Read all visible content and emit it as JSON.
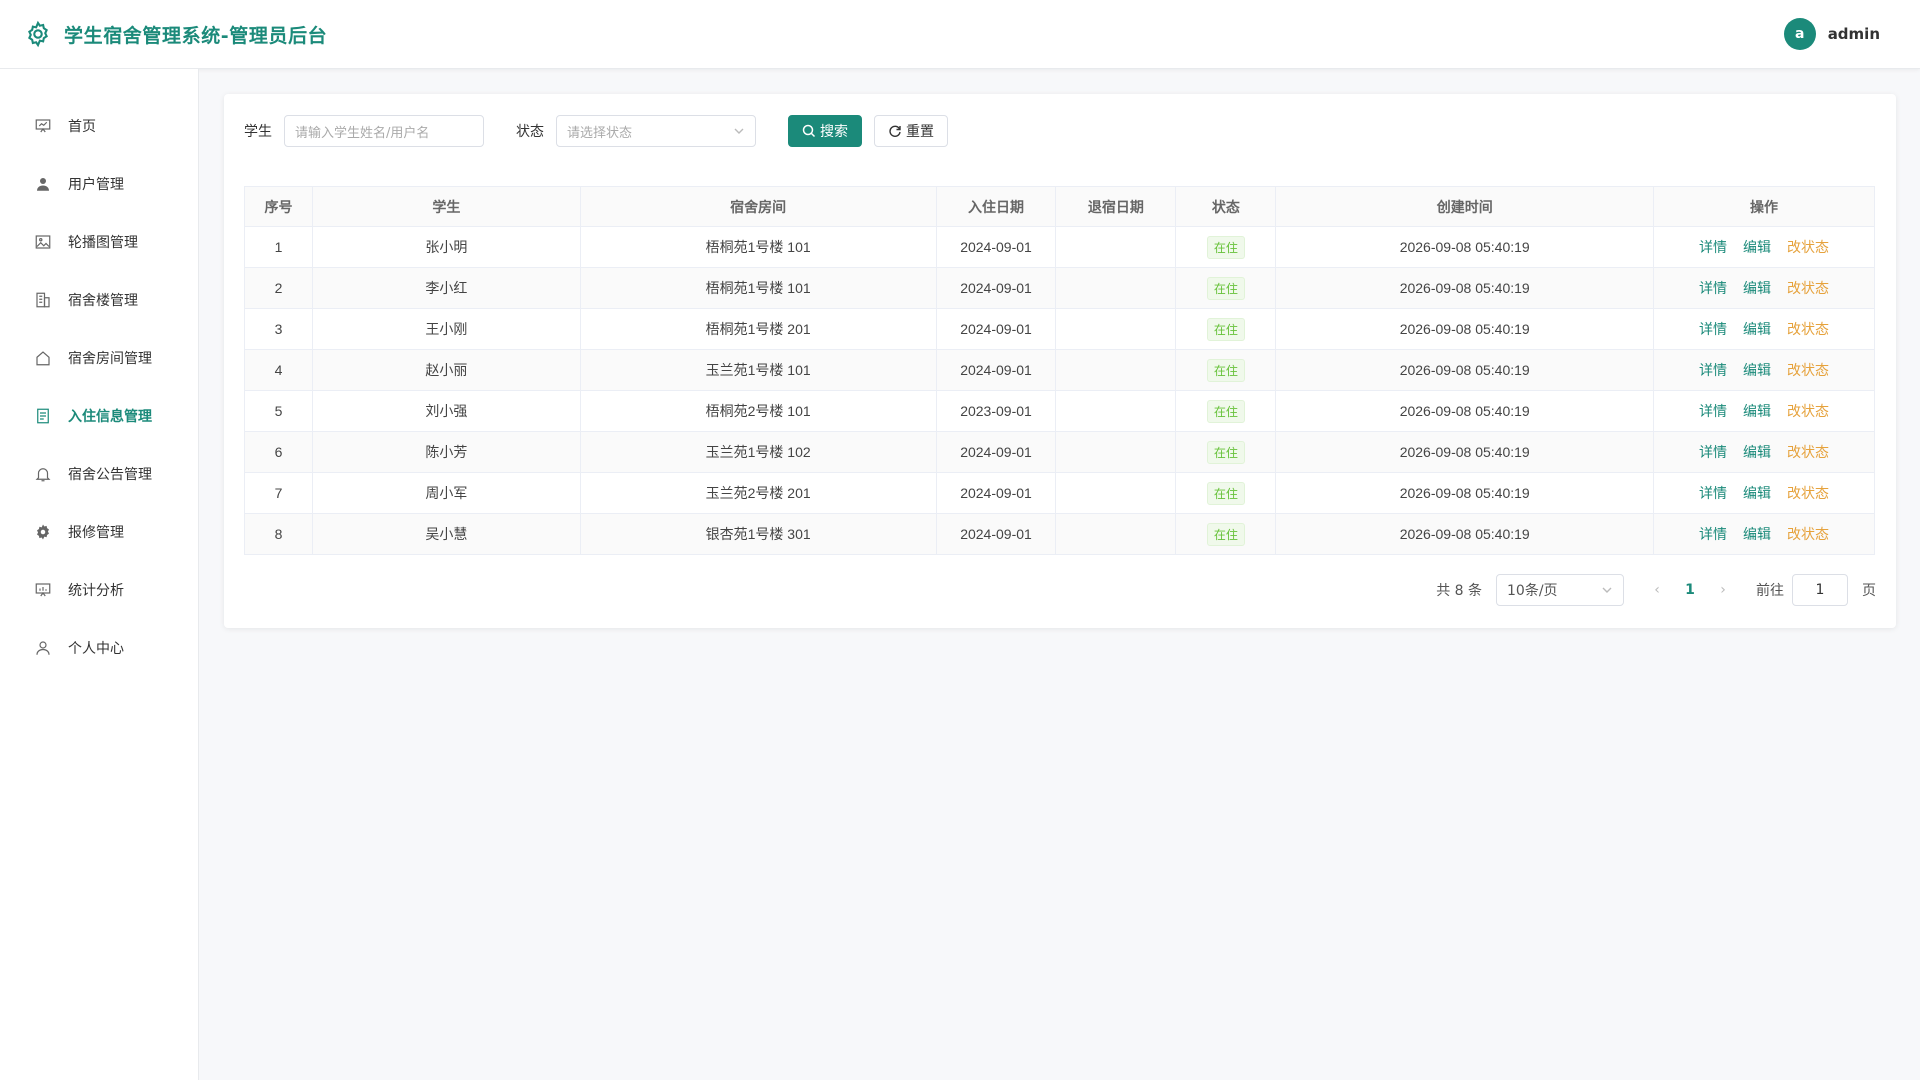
{
  "header": {
    "title": "学生宿舍管理系统-管理员后台",
    "avatar_letter": "a",
    "username": "admin"
  },
  "sidebar": {
    "items": [
      {
        "label": "首页",
        "icon": "home-chart-icon",
        "active": false
      },
      {
        "label": "用户管理",
        "icon": "user-icon",
        "active": false
      },
      {
        "label": "轮播图管理",
        "icon": "picture-icon",
        "active": false
      },
      {
        "label": "宿舍楼管理",
        "icon": "building-icon",
        "active": false
      },
      {
        "label": "宿舍房间管理",
        "icon": "house-icon",
        "active": false
      },
      {
        "label": "入住信息管理",
        "icon": "document-icon",
        "active": true
      },
      {
        "label": "宿舍公告管理",
        "icon": "bell-icon",
        "active": false
      },
      {
        "label": "报修管理",
        "icon": "gear-icon",
        "active": false
      },
      {
        "label": "统计分析",
        "icon": "chart-board-icon",
        "active": false
      },
      {
        "label": "个人中心",
        "icon": "person-outline-icon",
        "active": false
      }
    ]
  },
  "filters": {
    "student_label": "学生",
    "student_placeholder": "请输入学生姓名/用户名",
    "status_label": "状态",
    "status_placeholder": "请选择状态",
    "search_label": "搜索",
    "reset_label": "重置"
  },
  "table": {
    "columns": [
      "序号",
      "学生",
      "宿舍房间",
      "入住日期",
      "退宿日期",
      "状态",
      "创建时间",
      "操作"
    ],
    "rows": [
      {
        "index": "1",
        "student": "张小明",
        "room": "梧桐苑1号楼 101",
        "checkin": "2024-09-01",
        "checkout": "",
        "status": "在住",
        "created": "2026-09-08 05:40:19"
      },
      {
        "index": "2",
        "student": "李小红",
        "room": "梧桐苑1号楼 101",
        "checkin": "2024-09-01",
        "checkout": "",
        "status": "在住",
        "created": "2026-09-08 05:40:19"
      },
      {
        "index": "3",
        "student": "王小刚",
        "room": "梧桐苑1号楼 201",
        "checkin": "2024-09-01",
        "checkout": "",
        "status": "在住",
        "created": "2026-09-08 05:40:19"
      },
      {
        "index": "4",
        "student": "赵小丽",
        "room": "玉兰苑1号楼 101",
        "checkin": "2024-09-01",
        "checkout": "",
        "status": "在住",
        "created": "2026-09-08 05:40:19"
      },
      {
        "index": "5",
        "student": "刘小强",
        "room": "梧桐苑2号楼 101",
        "checkin": "2023-09-01",
        "checkout": "",
        "status": "在住",
        "created": "2026-09-08 05:40:19"
      },
      {
        "index": "6",
        "student": "陈小芳",
        "room": "玉兰苑1号楼 102",
        "checkin": "2024-09-01",
        "checkout": "",
        "status": "在住",
        "created": "2026-09-08 05:40:19"
      },
      {
        "index": "7",
        "student": "周小军",
        "room": "玉兰苑2号楼 201",
        "checkin": "2024-09-01",
        "checkout": "",
        "status": "在住",
        "created": "2026-09-08 05:40:19"
      },
      {
        "index": "8",
        "student": "吴小慧",
        "room": "银杏苑1号楼 301",
        "checkin": "2024-09-01",
        "checkout": "",
        "status": "在住",
        "created": "2026-09-08 05:40:19"
      }
    ],
    "actions": {
      "detail": "详情",
      "edit": "编辑",
      "change_status": "改状态"
    }
  },
  "pagination": {
    "total_text": "共 8 条",
    "page_size": "10条/页",
    "current_page": "1",
    "goto_label": "前往",
    "goto_value": "1",
    "page_suffix": "页"
  },
  "colors": {
    "accent": "#1b8a7a",
    "status_green": "#67c23a",
    "action_orange": "#e6a23c"
  }
}
